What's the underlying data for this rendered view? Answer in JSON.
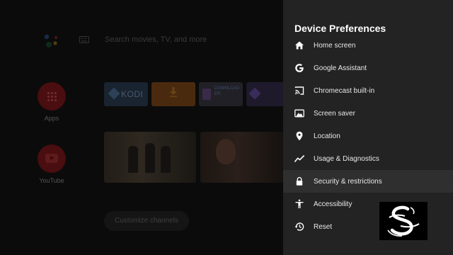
{
  "home": {
    "search_placeholder": "Search movies, TV, and more",
    "side_apps": [
      {
        "label": "Apps",
        "icon": "apps-grid-icon"
      },
      {
        "label": "YouTube",
        "icon": "youtube-icon"
      }
    ],
    "tiles": {
      "kodi": "KODI",
      "downloader_lines": [
        "DOWNLOAD",
        "ER"
      ]
    },
    "customize_label": "Customize channels"
  },
  "panel": {
    "title": "Device Preferences",
    "items": [
      {
        "label": "Home screen",
        "icon": "home-icon"
      },
      {
        "label": "Google Assistant",
        "icon": "google-g-icon"
      },
      {
        "label": "Chromecast built-in",
        "icon": "cast-icon"
      },
      {
        "label": "Screen saver",
        "icon": "screen-saver-icon"
      },
      {
        "label": "Location",
        "icon": "location-pin-icon"
      },
      {
        "label": "Usage & Diagnostics",
        "icon": "trending-line-icon"
      },
      {
        "label": "Security & restrictions",
        "icon": "lock-icon",
        "selected": true
      },
      {
        "label": "Accessibility",
        "icon": "accessibility-icon"
      },
      {
        "label": "Reset",
        "icon": "reset-history-icon"
      }
    ]
  },
  "colors": {
    "panel_bg": "#232323",
    "selected_bg": "#2f2f2f",
    "text": "#e8e8e8",
    "title": "#ffffff",
    "dimmed_bg": "#0b0b0b"
  }
}
